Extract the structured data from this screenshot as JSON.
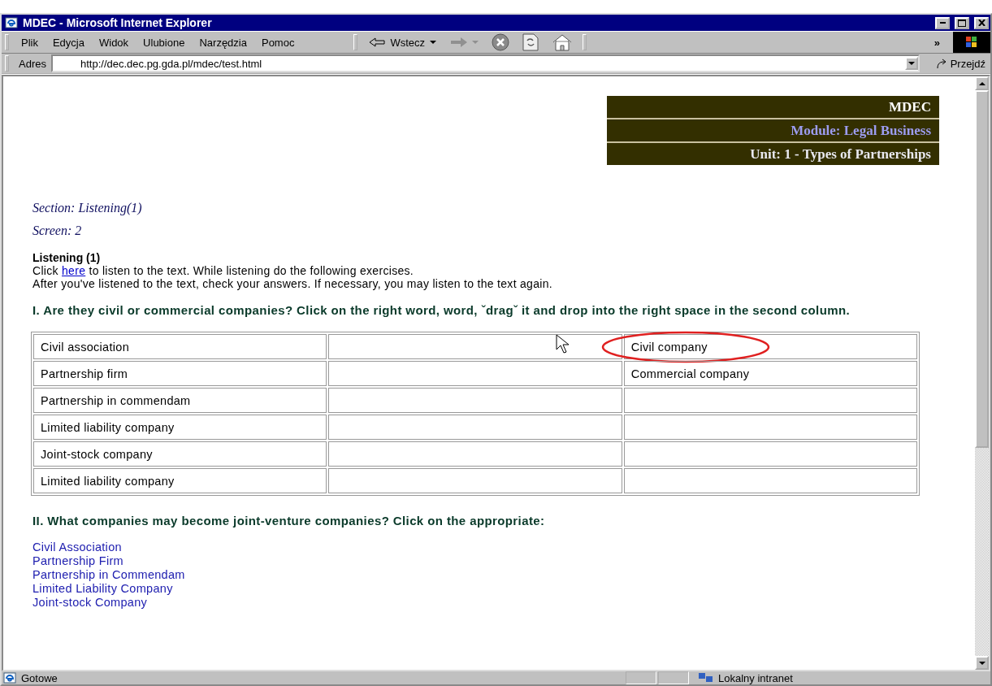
{
  "window": {
    "title": "MDEC - Microsoft Internet Explorer"
  },
  "menu": [
    "Plik",
    "Edycja",
    "Widok",
    "Ulubione",
    "Narzędzia",
    "Pomoc"
  ],
  "toolbar": {
    "back_label": "Wstecz",
    "more": "»"
  },
  "address": {
    "label": "Adres",
    "url": "http://dec.dec.pg.gda.pl/mdec/test.html",
    "go": "Przejdź"
  },
  "header_box": [
    {
      "text": "MDEC",
      "color": "#ffffff"
    },
    {
      "text": "Module: Legal Business",
      "color": "#9c9cf0"
    },
    {
      "text": "Unit: 1 - Types of Partnerships",
      "color": "#e8e8f0"
    }
  ],
  "section": "Section: Listening(1)",
  "screen": "Screen: 2",
  "heading": "Listening (1)",
  "intro": {
    "before": "Click ",
    "link": "here",
    "after": " to listen to the text. While listening do the following exercises."
  },
  "note": "After you've listened to the text, check your answers. If necessary, you may listen to the text again.",
  "exercise_1": {
    "instruction": "I. Are they civil or commercial companies? Click on the right word, word, ˇdragˇ it and drop into the right space in the second column.",
    "rows": [
      {
        "term": "Civil association",
        "answer": "Civil company",
        "highlighted": true
      },
      {
        "term": "Partnership firm",
        "answer": "Commercial company",
        "highlighted": false
      },
      {
        "term": "Partnership in commendam",
        "highlighted": false
      },
      {
        "term": "Limited liability company",
        "highlighted": false
      },
      {
        "term": "Joint-stock company",
        "highlighted": false
      },
      {
        "term": "Limited liability company",
        "highlighted": false
      }
    ]
  },
  "exercise_2": {
    "instruction": "II. What companies may become joint-venture companies? Click on the appropriate:",
    "options": [
      "Civil Association",
      "Partnership Firm",
      "Partnership in Commendam",
      "Limited Liability Company",
      "Joint-stock Company"
    ]
  },
  "status_bar": {
    "text": "Gotowe",
    "zone": "Lokalny intranet"
  }
}
